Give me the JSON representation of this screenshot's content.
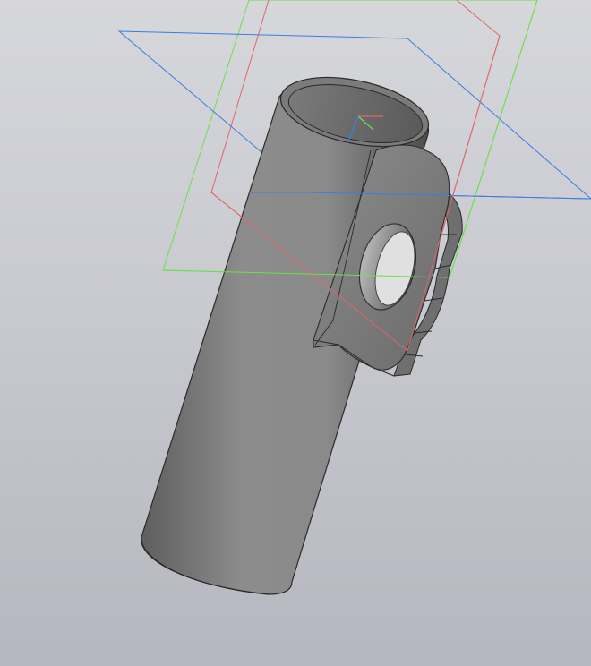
{
  "viewport": {
    "background_top": "#d6d7db",
    "background_bottom": "#b5b6bf"
  },
  "planes": [
    {
      "name": "XY",
      "color": "#3b7de0"
    },
    {
      "name": "ZY",
      "color": "#e06666"
    },
    {
      "name": "XZ",
      "color": "#6be04a"
    }
  ],
  "model": {
    "name": "tube-with-lug",
    "body_color": "#8a8a8a",
    "edge_color": "#2a2a2a"
  },
  "triad": {
    "x_color": "#e06666",
    "y_color": "#6be04a",
    "z_color": "#3b7de0"
  }
}
